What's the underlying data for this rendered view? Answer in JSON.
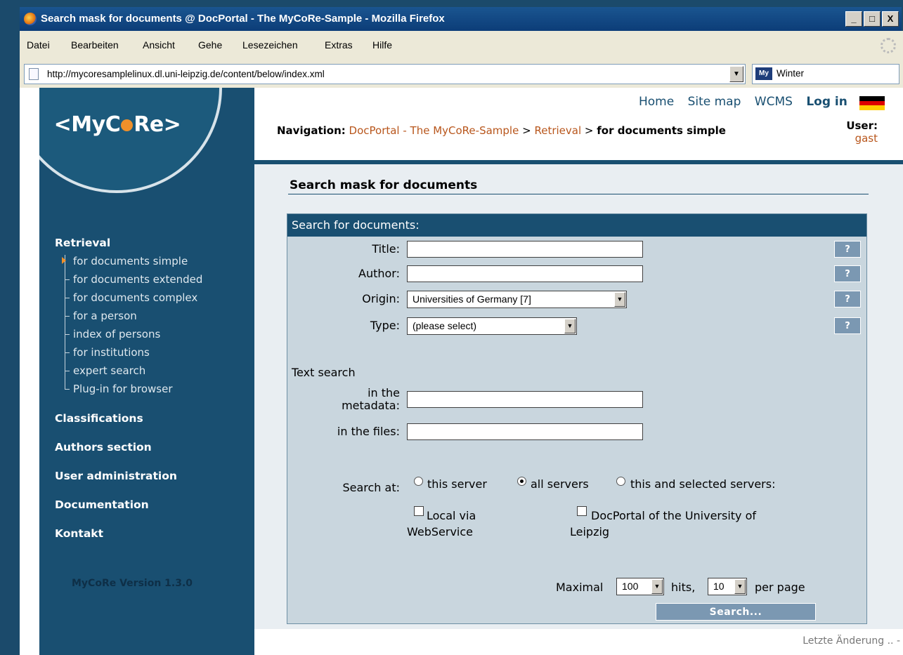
{
  "window": {
    "title": "Search mask for documents @ DocPortal - The MyCoRe-Sample - Mozilla Firefox",
    "controls": [
      "_",
      "□",
      "X"
    ]
  },
  "menu": [
    "Datei",
    "Bearbeiten",
    "Ansicht",
    "Gehe",
    "Lesezeichen",
    "Extras",
    "Hilfe"
  ],
  "address": {
    "url": "http://mycoresamplelinux.dl.uni-leipzig.de/content/below/index.xml",
    "search_value": "Winter",
    "search_engine": "My"
  },
  "logo": {
    "left": "<MyC",
    "right": "Re>"
  },
  "sidebar": {
    "retrieval_heading": "Retrieval",
    "retrieval_items": [
      "for documents simple",
      "for documents extended",
      "for documents complex",
      "for a person",
      "index of persons",
      "for institutions",
      "expert search",
      "Plug-in for browser"
    ],
    "sections": [
      "Classifications",
      "Authors section",
      "User administration",
      "Documentation",
      "Kontakt"
    ],
    "version": "MyCoRe Version 1.3.0"
  },
  "top_links": {
    "home": "Home",
    "sitemap": "Site map",
    "wcms": "WCMS",
    "login": "Log in",
    "separator": "|"
  },
  "breadcrumb": {
    "label": "Navigation:",
    "items": [
      "DocPortal - The MyCoRe-Sample",
      "Retrieval"
    ],
    "sep": ">",
    "current": "for documents simple"
  },
  "user": {
    "label": "User:",
    "name": "gast"
  },
  "main": {
    "section_title": "Search mask for documents",
    "form_title": "Search for documents:",
    "title_label": "Title:",
    "author_label": "Author:",
    "origin_label": "Origin:",
    "origin_value": "Universities of Germany [7]",
    "type_label": "Type:",
    "type_value": "(please select)",
    "help": "?",
    "text_search_label": "Text search",
    "metadata_label_1": "in the",
    "metadata_label_2": "metadata:",
    "files_label": "in the files:",
    "search_at_label": "Search at:",
    "radio_this": "this server",
    "radio_all": "all servers",
    "radio_selected": "this and selected servers:",
    "check_local_1": "Local via",
    "check_local_2": "WebService",
    "check_docportal_1": "DocPortal of the University of",
    "check_docportal_2": "Leipzig",
    "maximal_label": "Maximal",
    "maximal_value": "100",
    "hits_label": "hits,",
    "per_page_value": "10",
    "per_page_label": "per page",
    "search_button": "Search..."
  },
  "footer": {
    "text": "Letzte Änderung .. -"
  },
  "colors": {
    "brand_blue": "#194f71",
    "link_orange": "#b8561c",
    "accent_orange": "#f0902a"
  },
  "icons": [
    "firefox-icon",
    "page-icon",
    "search-engine-icon",
    "throbber-icon",
    "german-flag-icon",
    "tree-arrow-icon"
  ]
}
